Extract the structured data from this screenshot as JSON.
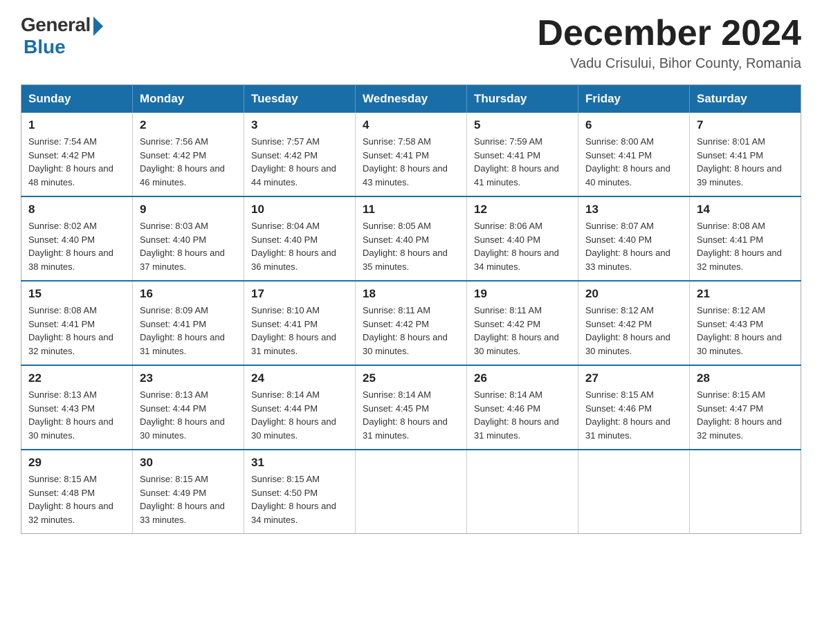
{
  "logo": {
    "general": "General",
    "blue": "Blue"
  },
  "title": "December 2024",
  "location": "Vadu Crisului, Bihor County, Romania",
  "days_of_week": [
    "Sunday",
    "Monday",
    "Tuesday",
    "Wednesday",
    "Thursday",
    "Friday",
    "Saturday"
  ],
  "weeks": [
    [
      {
        "day": "1",
        "sunrise": "7:54 AM",
        "sunset": "4:42 PM",
        "daylight": "8 hours and 48 minutes."
      },
      {
        "day": "2",
        "sunrise": "7:56 AM",
        "sunset": "4:42 PM",
        "daylight": "8 hours and 46 minutes."
      },
      {
        "day": "3",
        "sunrise": "7:57 AM",
        "sunset": "4:42 PM",
        "daylight": "8 hours and 44 minutes."
      },
      {
        "day": "4",
        "sunrise": "7:58 AM",
        "sunset": "4:41 PM",
        "daylight": "8 hours and 43 minutes."
      },
      {
        "day": "5",
        "sunrise": "7:59 AM",
        "sunset": "4:41 PM",
        "daylight": "8 hours and 41 minutes."
      },
      {
        "day": "6",
        "sunrise": "8:00 AM",
        "sunset": "4:41 PM",
        "daylight": "8 hours and 40 minutes."
      },
      {
        "day": "7",
        "sunrise": "8:01 AM",
        "sunset": "4:41 PM",
        "daylight": "8 hours and 39 minutes."
      }
    ],
    [
      {
        "day": "8",
        "sunrise": "8:02 AM",
        "sunset": "4:40 PM",
        "daylight": "8 hours and 38 minutes."
      },
      {
        "day": "9",
        "sunrise": "8:03 AM",
        "sunset": "4:40 PM",
        "daylight": "8 hours and 37 minutes."
      },
      {
        "day": "10",
        "sunrise": "8:04 AM",
        "sunset": "4:40 PM",
        "daylight": "8 hours and 36 minutes."
      },
      {
        "day": "11",
        "sunrise": "8:05 AM",
        "sunset": "4:40 PM",
        "daylight": "8 hours and 35 minutes."
      },
      {
        "day": "12",
        "sunrise": "8:06 AM",
        "sunset": "4:40 PM",
        "daylight": "8 hours and 34 minutes."
      },
      {
        "day": "13",
        "sunrise": "8:07 AM",
        "sunset": "4:40 PM",
        "daylight": "8 hours and 33 minutes."
      },
      {
        "day": "14",
        "sunrise": "8:08 AM",
        "sunset": "4:41 PM",
        "daylight": "8 hours and 32 minutes."
      }
    ],
    [
      {
        "day": "15",
        "sunrise": "8:08 AM",
        "sunset": "4:41 PM",
        "daylight": "8 hours and 32 minutes."
      },
      {
        "day": "16",
        "sunrise": "8:09 AM",
        "sunset": "4:41 PM",
        "daylight": "8 hours and 31 minutes."
      },
      {
        "day": "17",
        "sunrise": "8:10 AM",
        "sunset": "4:41 PM",
        "daylight": "8 hours and 31 minutes."
      },
      {
        "day": "18",
        "sunrise": "8:11 AM",
        "sunset": "4:42 PM",
        "daylight": "8 hours and 30 minutes."
      },
      {
        "day": "19",
        "sunrise": "8:11 AM",
        "sunset": "4:42 PM",
        "daylight": "8 hours and 30 minutes."
      },
      {
        "day": "20",
        "sunrise": "8:12 AM",
        "sunset": "4:42 PM",
        "daylight": "8 hours and 30 minutes."
      },
      {
        "day": "21",
        "sunrise": "8:12 AM",
        "sunset": "4:43 PM",
        "daylight": "8 hours and 30 minutes."
      }
    ],
    [
      {
        "day": "22",
        "sunrise": "8:13 AM",
        "sunset": "4:43 PM",
        "daylight": "8 hours and 30 minutes."
      },
      {
        "day": "23",
        "sunrise": "8:13 AM",
        "sunset": "4:44 PM",
        "daylight": "8 hours and 30 minutes."
      },
      {
        "day": "24",
        "sunrise": "8:14 AM",
        "sunset": "4:44 PM",
        "daylight": "8 hours and 30 minutes."
      },
      {
        "day": "25",
        "sunrise": "8:14 AM",
        "sunset": "4:45 PM",
        "daylight": "8 hours and 31 minutes."
      },
      {
        "day": "26",
        "sunrise": "8:14 AM",
        "sunset": "4:46 PM",
        "daylight": "8 hours and 31 minutes."
      },
      {
        "day": "27",
        "sunrise": "8:15 AM",
        "sunset": "4:46 PM",
        "daylight": "8 hours and 31 minutes."
      },
      {
        "day": "28",
        "sunrise": "8:15 AM",
        "sunset": "4:47 PM",
        "daylight": "8 hours and 32 minutes."
      }
    ],
    [
      {
        "day": "29",
        "sunrise": "8:15 AM",
        "sunset": "4:48 PM",
        "daylight": "8 hours and 32 minutes."
      },
      {
        "day": "30",
        "sunrise": "8:15 AM",
        "sunset": "4:49 PM",
        "daylight": "8 hours and 33 minutes."
      },
      {
        "day": "31",
        "sunrise": "8:15 AM",
        "sunset": "4:50 PM",
        "daylight": "8 hours and 34 minutes."
      },
      null,
      null,
      null,
      null
    ]
  ]
}
